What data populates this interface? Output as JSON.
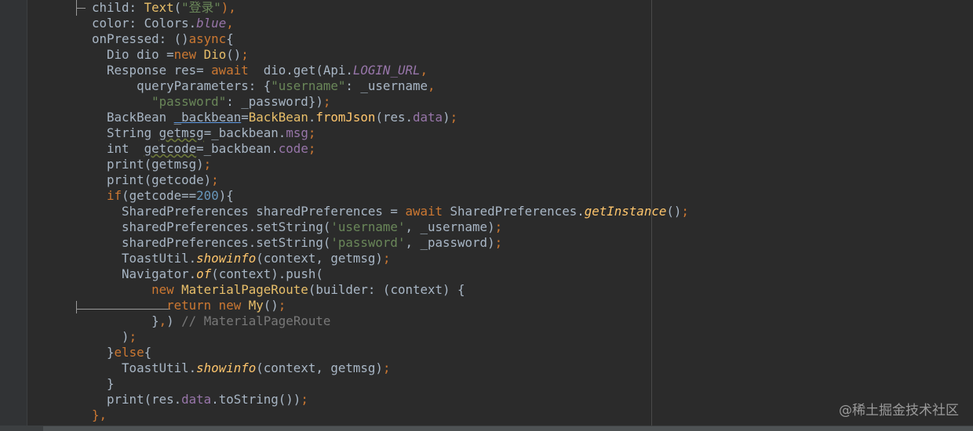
{
  "editor": {
    "lines": [
      [
        {
          "t": "child: ",
          "c": "default"
        },
        {
          "t": "Text",
          "c": "class"
        },
        {
          "t": "(",
          "c": "default"
        },
        {
          "t": "\"登录\"",
          "c": "string"
        },
        {
          "t": "),",
          "c": "keyword"
        }
      ],
      [
        {
          "t": "color: Colors.",
          "c": "default"
        },
        {
          "t": "blue",
          "c": "constant"
        },
        {
          "t": ",",
          "c": "keyword"
        }
      ],
      [
        {
          "t": "onPressed: ()",
          "c": "default"
        },
        {
          "t": "async",
          "c": "keyword"
        },
        {
          "t": "{",
          "c": "default"
        }
      ],
      [
        {
          "t": "  Dio dio =",
          "c": "default"
        },
        {
          "t": "new ",
          "c": "keyword"
        },
        {
          "t": "Dio",
          "c": "class"
        },
        {
          "t": "()",
          "c": "default"
        },
        {
          "t": ";",
          "c": "keyword"
        }
      ],
      [
        {
          "t": "  Response res= ",
          "c": "default"
        },
        {
          "t": "await",
          "c": "keyword"
        },
        {
          "t": "  dio.get(Api.",
          "c": "default"
        },
        {
          "t": "LOGIN_URL",
          "c": "constant"
        },
        {
          "t": ",",
          "c": "keyword"
        }
      ],
      [
        {
          "t": "      queryParameters: {",
          "c": "default"
        },
        {
          "t": "\"username\"",
          "c": "string"
        },
        {
          "t": ": _username",
          "c": "default"
        },
        {
          "t": ",",
          "c": "keyword"
        }
      ],
      [
        {
          "t": "        ",
          "c": "default"
        },
        {
          "t": "\"password\"",
          "c": "string"
        },
        {
          "t": ": _password})",
          "c": "default"
        },
        {
          "t": ";",
          "c": "keyword"
        }
      ],
      [
        {
          "t": "  BackBean ",
          "c": "default"
        },
        {
          "t": "_backbean",
          "c": "underline"
        },
        {
          "t": "=",
          "c": "default"
        },
        {
          "t": "BackBean",
          "c": "class"
        },
        {
          "t": ".",
          "c": "default"
        },
        {
          "t": "fromJson",
          "c": "func"
        },
        {
          "t": "(res.",
          "c": "default"
        },
        {
          "t": "data",
          "c": "field"
        },
        {
          "t": ")",
          "c": "default"
        },
        {
          "t": ";",
          "c": "keyword"
        }
      ],
      [
        {
          "t": "  String ",
          "c": "default"
        },
        {
          "t": "getmsg",
          "c": "squiggle"
        },
        {
          "t": "=_backbean.",
          "c": "default"
        },
        {
          "t": "msg",
          "c": "field"
        },
        {
          "t": ";",
          "c": "keyword"
        }
      ],
      [
        {
          "t": "  int  ",
          "c": "default"
        },
        {
          "t": "getcode",
          "c": "squiggle"
        },
        {
          "t": "=_backbean.",
          "c": "default"
        },
        {
          "t": "code",
          "c": "field"
        },
        {
          "t": ";",
          "c": "keyword"
        }
      ],
      [
        {
          "t": "  print(getmsg)",
          "c": "default"
        },
        {
          "t": ";",
          "c": "keyword"
        }
      ],
      [
        {
          "t": "  print(getcode)",
          "c": "default"
        },
        {
          "t": ";",
          "c": "keyword"
        }
      ],
      [
        {
          "t": "  ",
          "c": "default"
        },
        {
          "t": "if",
          "c": "keyword"
        },
        {
          "t": "(getcode==",
          "c": "default"
        },
        {
          "t": "200",
          "c": "number"
        },
        {
          "t": "){",
          "c": "default"
        }
      ],
      [
        {
          "t": "    SharedPreferences sharedPreferences = ",
          "c": "default"
        },
        {
          "t": "await ",
          "c": "keyword"
        },
        {
          "t": "SharedPreferences.",
          "c": "default"
        },
        {
          "t": "getInstance",
          "c": "italic"
        },
        {
          "t": "()",
          "c": "default"
        },
        {
          "t": ";",
          "c": "keyword"
        }
      ],
      [
        {
          "t": "    sharedPreferences.setString(",
          "c": "default"
        },
        {
          "t": "'username'",
          "c": "string"
        },
        {
          "t": ", _username)",
          "c": "default"
        },
        {
          "t": ";",
          "c": "keyword"
        }
      ],
      [
        {
          "t": "    sharedPreferences.setString(",
          "c": "default"
        },
        {
          "t": "'password'",
          "c": "string"
        },
        {
          "t": ", _password)",
          "c": "default"
        },
        {
          "t": ";",
          "c": "keyword"
        }
      ],
      [
        {
          "t": "    ToastUtil.",
          "c": "default"
        },
        {
          "t": "showinfo",
          "c": "italic"
        },
        {
          "t": "(context, getmsg)",
          "c": "default"
        },
        {
          "t": ";",
          "c": "keyword"
        }
      ],
      [
        {
          "t": "    Navigator.",
          "c": "default"
        },
        {
          "t": "of",
          "c": "italic"
        },
        {
          "t": "(context).push(",
          "c": "default"
        }
      ],
      [
        {
          "t": "        ",
          "c": "default"
        },
        {
          "t": "new ",
          "c": "keyword"
        },
        {
          "t": "MaterialPageRoute",
          "c": "class"
        },
        {
          "t": "(builder: (context) {",
          "c": "default"
        }
      ],
      [
        {
          "t": "          ",
          "c": "default"
        },
        {
          "t": "return new ",
          "c": "keyword"
        },
        {
          "t": "My",
          "c": "class"
        },
        {
          "t": "()",
          "c": "default"
        },
        {
          "t": ";",
          "c": "keyword"
        }
      ],
      [
        {
          "t": "        }",
          "c": "default"
        },
        {
          "t": ",",
          "c": "keyword"
        },
        {
          "t": ") ",
          "c": "default"
        },
        {
          "t": "// MaterialPageRoute",
          "c": "hint"
        }
      ],
      [
        {
          "t": "    )",
          "c": "default"
        },
        {
          "t": ";",
          "c": "keyword"
        }
      ],
      [
        {
          "t": "  }",
          "c": "default"
        },
        {
          "t": "else",
          "c": "keyword"
        },
        {
          "t": "{",
          "c": "default"
        }
      ],
      [
        {
          "t": "    ToastUtil.",
          "c": "default"
        },
        {
          "t": "showinfo",
          "c": "italic"
        },
        {
          "t": "(context, getmsg)",
          "c": "default"
        },
        {
          "t": ";",
          "c": "keyword"
        }
      ],
      [
        {
          "t": "  }",
          "c": "default"
        }
      ],
      [
        {
          "t": "  print(res.",
          "c": "default"
        },
        {
          "t": "data",
          "c": "field"
        },
        {
          "t": ".toString())",
          "c": "default"
        },
        {
          "t": ";",
          "c": "keyword"
        }
      ],
      [
        {
          "t": "},",
          "c": "keyword"
        }
      ]
    ]
  },
  "watermark": {
    "text": "@稀土掘金技术社区"
  },
  "colors": {
    "background": "#2b2b2b",
    "keyword": "#cc7832",
    "string": "#6a8759",
    "number": "#6897bb",
    "function": "#ffc66d",
    "field": "#9876aa",
    "comment": "#787878"
  }
}
